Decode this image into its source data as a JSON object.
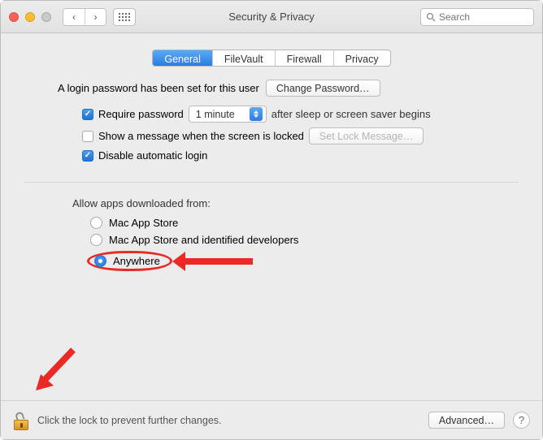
{
  "window": {
    "title": "Security & Privacy"
  },
  "search": {
    "placeholder": "Search"
  },
  "tabs": {
    "general": "General",
    "filevault": "FileVault",
    "firewall": "Firewall",
    "privacy": "Privacy",
    "active": "general"
  },
  "password": {
    "info": "A login password has been set for this user",
    "change_btn": "Change Password…",
    "require_label": "Require password",
    "delay_value": "1 minute",
    "after_text": "after sleep or screen saver begins",
    "require_checked": true,
    "show_message_label": "Show a message when the screen is locked",
    "show_message_checked": false,
    "set_lock_btn": "Set Lock Message…",
    "disable_auto_label": "Disable automatic login",
    "disable_auto_checked": true
  },
  "download": {
    "section_label": "Allow apps downloaded from:",
    "opt_mas": "Mac App Store",
    "opt_mas_dev": "Mac App Store and identified developers",
    "opt_anywhere": "Anywhere",
    "selected": "anywhere"
  },
  "footer": {
    "lock_text": "Click the lock to prevent further changes.",
    "advanced_btn": "Advanced…"
  },
  "annotations": {
    "highlight_option": "anywhere",
    "arrow_to_option": true,
    "arrow_to_lock": true
  }
}
